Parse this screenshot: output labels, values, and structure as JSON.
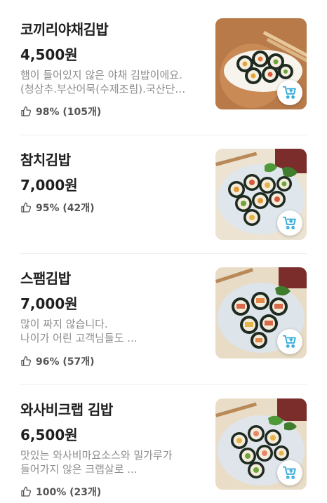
{
  "colors": {
    "accent": "#2fa8d8",
    "title": "#1f1f1f",
    "description": "#8c8c8c",
    "divider": "#eeeeee"
  },
  "icons": {
    "rating": "thumbs-up-icon",
    "cart": "add-to-cart-icon"
  },
  "items": [
    {
      "name": "코끼리야채김밥",
      "price": "4,500원",
      "description": [
        "햄이 들어있지 않은 야채 김밥이에요.",
        "(청상추.부산어묵(수제조림).국산단…"
      ],
      "rating": "98% (105개)"
    },
    {
      "name": "참치김밥",
      "price": "7,000원",
      "description": [],
      "rating": "95% (42개)"
    },
    {
      "name": "스팸김밥",
      "price": "7,000원",
      "description": [
        "많이 짜지 않습니다.",
        "나이가 어린 고객님들도  ..."
      ],
      "rating": "96% (57개)"
    },
    {
      "name": "와사비크랩 김밥",
      "price": "6,500원",
      "description": [
        "맛있는 와사비마요소스와 밀가루가",
        "들어가지 않은 크랩살로 ..."
      ],
      "rating": "100% (23개)"
    }
  ]
}
